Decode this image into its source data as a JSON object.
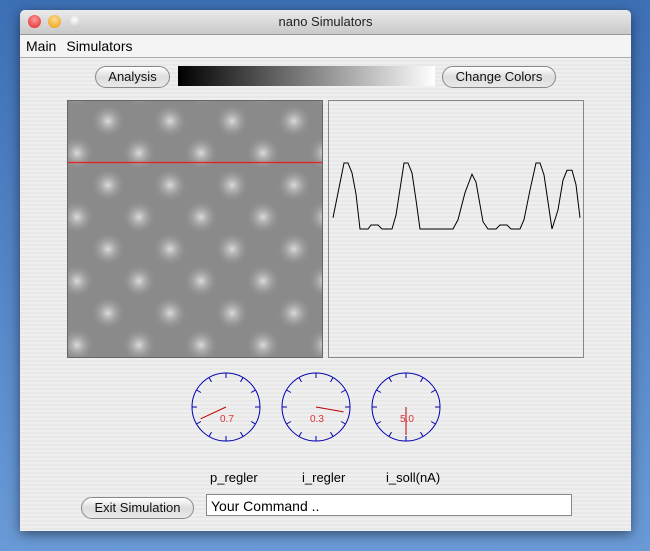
{
  "window": {
    "title": "nano Simulators"
  },
  "menu": [
    "Main",
    "Simulators"
  ],
  "toolbar": {
    "analysis": "Analysis",
    "change_colors": "Change Colors",
    "colormap": [
      "#000000",
      "#ffffff"
    ]
  },
  "scan": {
    "line_color": "#ff0000"
  },
  "profile": [
    [
      4,
      0.17
    ],
    [
      15,
      1
    ],
    [
      19,
      1
    ],
    [
      23,
      0.85
    ],
    [
      27,
      0.53
    ],
    [
      31,
      0
    ],
    [
      39,
      0
    ],
    [
      42,
      0.06
    ],
    [
      49,
      0.06
    ],
    [
      53,
      0
    ],
    [
      63,
      0
    ],
    [
      67,
      0.21
    ],
    [
      75,
      1
    ],
    [
      79,
      1
    ],
    [
      83,
      0.85
    ],
    [
      87,
      0.44
    ],
    [
      91,
      0
    ],
    [
      124,
      0
    ],
    [
      129,
      0.14
    ],
    [
      136,
      0.55
    ],
    [
      143,
      0.83
    ],
    [
      147,
      0.71
    ],
    [
      154,
      0.11
    ],
    [
      159,
      0
    ],
    [
      167,
      0
    ],
    [
      171,
      0.06
    ],
    [
      178,
      0.06
    ],
    [
      182,
      0
    ],
    [
      191,
      0
    ],
    [
      195,
      0.14
    ],
    [
      201,
      0.59
    ],
    [
      207,
      1
    ],
    [
      211,
      1
    ],
    [
      215,
      0.82
    ],
    [
      223,
      0
    ],
    [
      229,
      0.29
    ],
    [
      234,
      0.74
    ],
    [
      238,
      0.89
    ],
    [
      243,
      0.89
    ],
    [
      247,
      0.67
    ],
    [
      251,
      0.17
    ]
  ],
  "gauges": [
    {
      "label": "p_regler",
      "value": "0.7",
      "angle": -115
    },
    {
      "label": "i_regler",
      "value": "0.3",
      "angle": 100
    },
    {
      "label": "i_soll(nA)",
      "value": "5.0",
      "angle": 180
    }
  ],
  "footer": {
    "exit": "Exit Simulation",
    "command": "Your Command .."
  }
}
